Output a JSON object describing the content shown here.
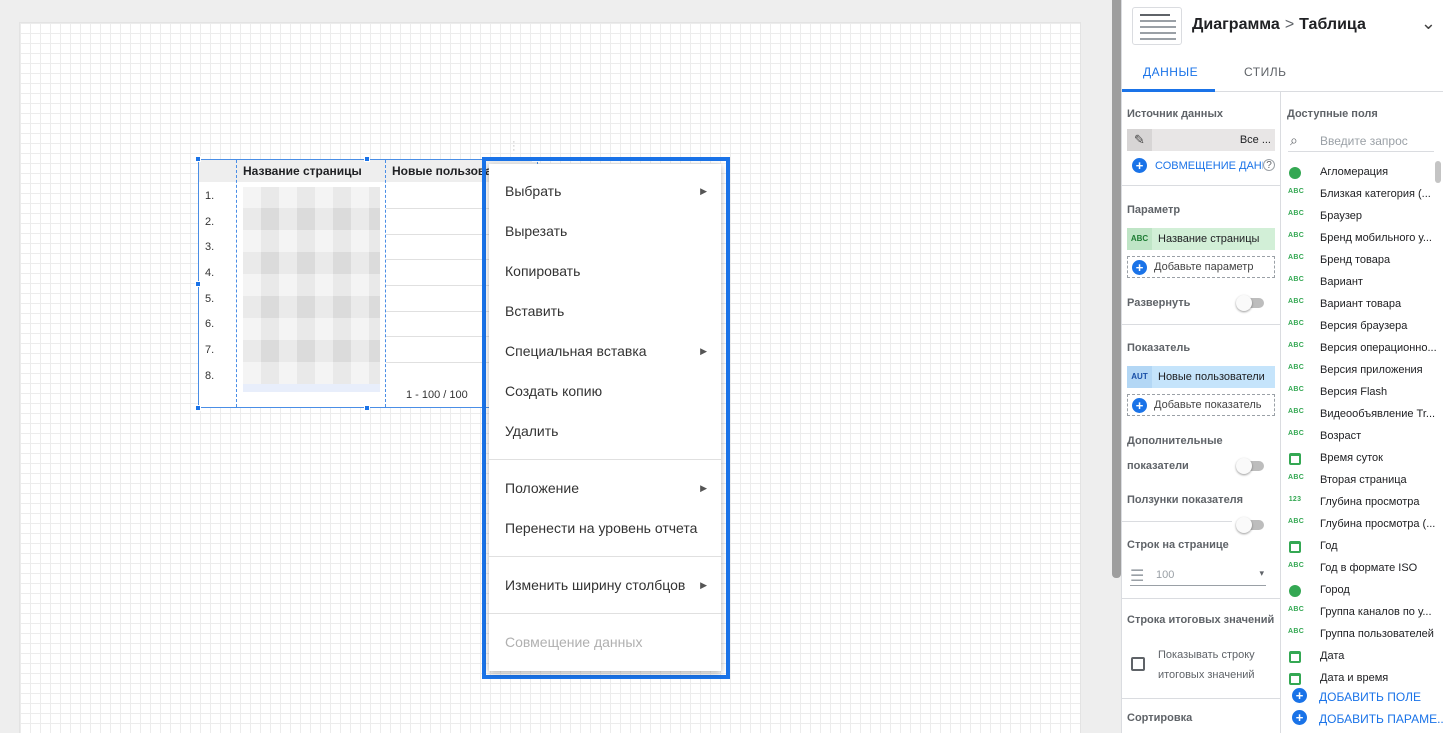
{
  "table": {
    "col1_header": "Название страницы",
    "col2_header": "Новые пользова",
    "row_numbers": [
      "1.",
      "2.",
      "3.",
      "4.",
      "5.",
      "6.",
      "7.",
      "8."
    ],
    "pagination": "1 - 100 / 100"
  },
  "context_menu": {
    "items": [
      {
        "label": "Выбрать",
        "submenu": true
      },
      {
        "label": "Вырезать",
        "submenu": false
      },
      {
        "label": "Копировать",
        "submenu": false
      },
      {
        "label": "Вставить",
        "submenu": false
      },
      {
        "label": "Специальная вставка",
        "submenu": true
      },
      {
        "label": "Создать копию",
        "submenu": false
      },
      {
        "label": "Удалить",
        "submenu": false
      },
      {
        "label": "Положение",
        "submenu": true
      },
      {
        "label": "Перенести на уровень отчета",
        "submenu": false
      },
      {
        "label": "Изменить ширину столбцов",
        "submenu": true
      },
      {
        "label": "Совмещение данных",
        "submenu": false,
        "disabled": true
      }
    ]
  },
  "panel": {
    "breadcrumb_parent": "Диаграмма",
    "breadcrumb_current": "Таблица",
    "tabs": {
      "data": "ДАННЫЕ",
      "style": "СТИЛЬ"
    },
    "data_source_label": "Источник данных",
    "data_source_value": "Все ...",
    "data_blend_link": "СОВМЕЩЕНИЕ ДАННЫХ",
    "dimension_label": "Параметр",
    "dimension_chip_type": "ABC",
    "dimension_chip": "Название страницы",
    "add_dimension": "Добавьте параметр",
    "drill_down_label": "Развернуть",
    "metric_label": "Показатель",
    "metric_chip_type": "AUT",
    "metric_chip": "Новые пользователи",
    "add_metric": "Добавьте показатель",
    "optional_metrics_label_line1": "Дополнительные",
    "optional_metrics_label_line2": "показатели",
    "metric_sliders_label": "Ползунки показателя",
    "rows_per_page_label": "Строк на странице",
    "rows_per_page_value": "100",
    "summary_row_label": "Строка итоговых значений",
    "show_summary_line1": "Показывать строку",
    "show_summary_line2": "итоговых значений",
    "sort_label": "Сортировка",
    "available_fields_label": "Доступные поля",
    "search_placeholder": "Введите запрос",
    "fields": [
      {
        "icon": "geo",
        "label": "Агломерация"
      },
      {
        "icon": "ABC",
        "label": "Близкая категория (..."
      },
      {
        "icon": "ABC",
        "label": "Браузер"
      },
      {
        "icon": "ABC",
        "label": "Бренд мобильного у..."
      },
      {
        "icon": "ABC",
        "label": "Бренд товара"
      },
      {
        "icon": "ABC",
        "label": "Вариант"
      },
      {
        "icon": "ABC",
        "label": "Вариант товара"
      },
      {
        "icon": "ABC",
        "label": "Версия браузера"
      },
      {
        "icon": "ABC",
        "label": "Версия операционно..."
      },
      {
        "icon": "ABC",
        "label": "Версия приложения"
      },
      {
        "icon": "ABC",
        "label": "Версия Flash"
      },
      {
        "icon": "ABC",
        "label": "Видеообъявление Tr..."
      },
      {
        "icon": "ABC",
        "label": "Возраст"
      },
      {
        "icon": "cal",
        "label": "Время суток"
      },
      {
        "icon": "ABC",
        "label": "Вторая страница"
      },
      {
        "icon": "123",
        "label": "Глубина просмотра"
      },
      {
        "icon": "ABC",
        "label": "Глубина просмотра (..."
      },
      {
        "icon": "cal",
        "label": "Год"
      },
      {
        "icon": "ABC",
        "label": "Год в формате ISO"
      },
      {
        "icon": "geo",
        "label": "Город"
      },
      {
        "icon": "ABC",
        "label": "Группа каналов по у..."
      },
      {
        "icon": "ABC",
        "label": "Группа пользователей"
      },
      {
        "icon": "cal",
        "label": "Дата"
      },
      {
        "icon": "cal",
        "label": "Дата и время"
      }
    ],
    "add_field": "ДОБАВИТЬ ПОЛЕ",
    "add_parameter": "ДОБАВИТЬ ПАРАМЕ..."
  },
  "colors": {
    "accent": "#1a73e8",
    "dimension_chip": "#d2efd7",
    "metric_chip": "#c5e4fb"
  }
}
